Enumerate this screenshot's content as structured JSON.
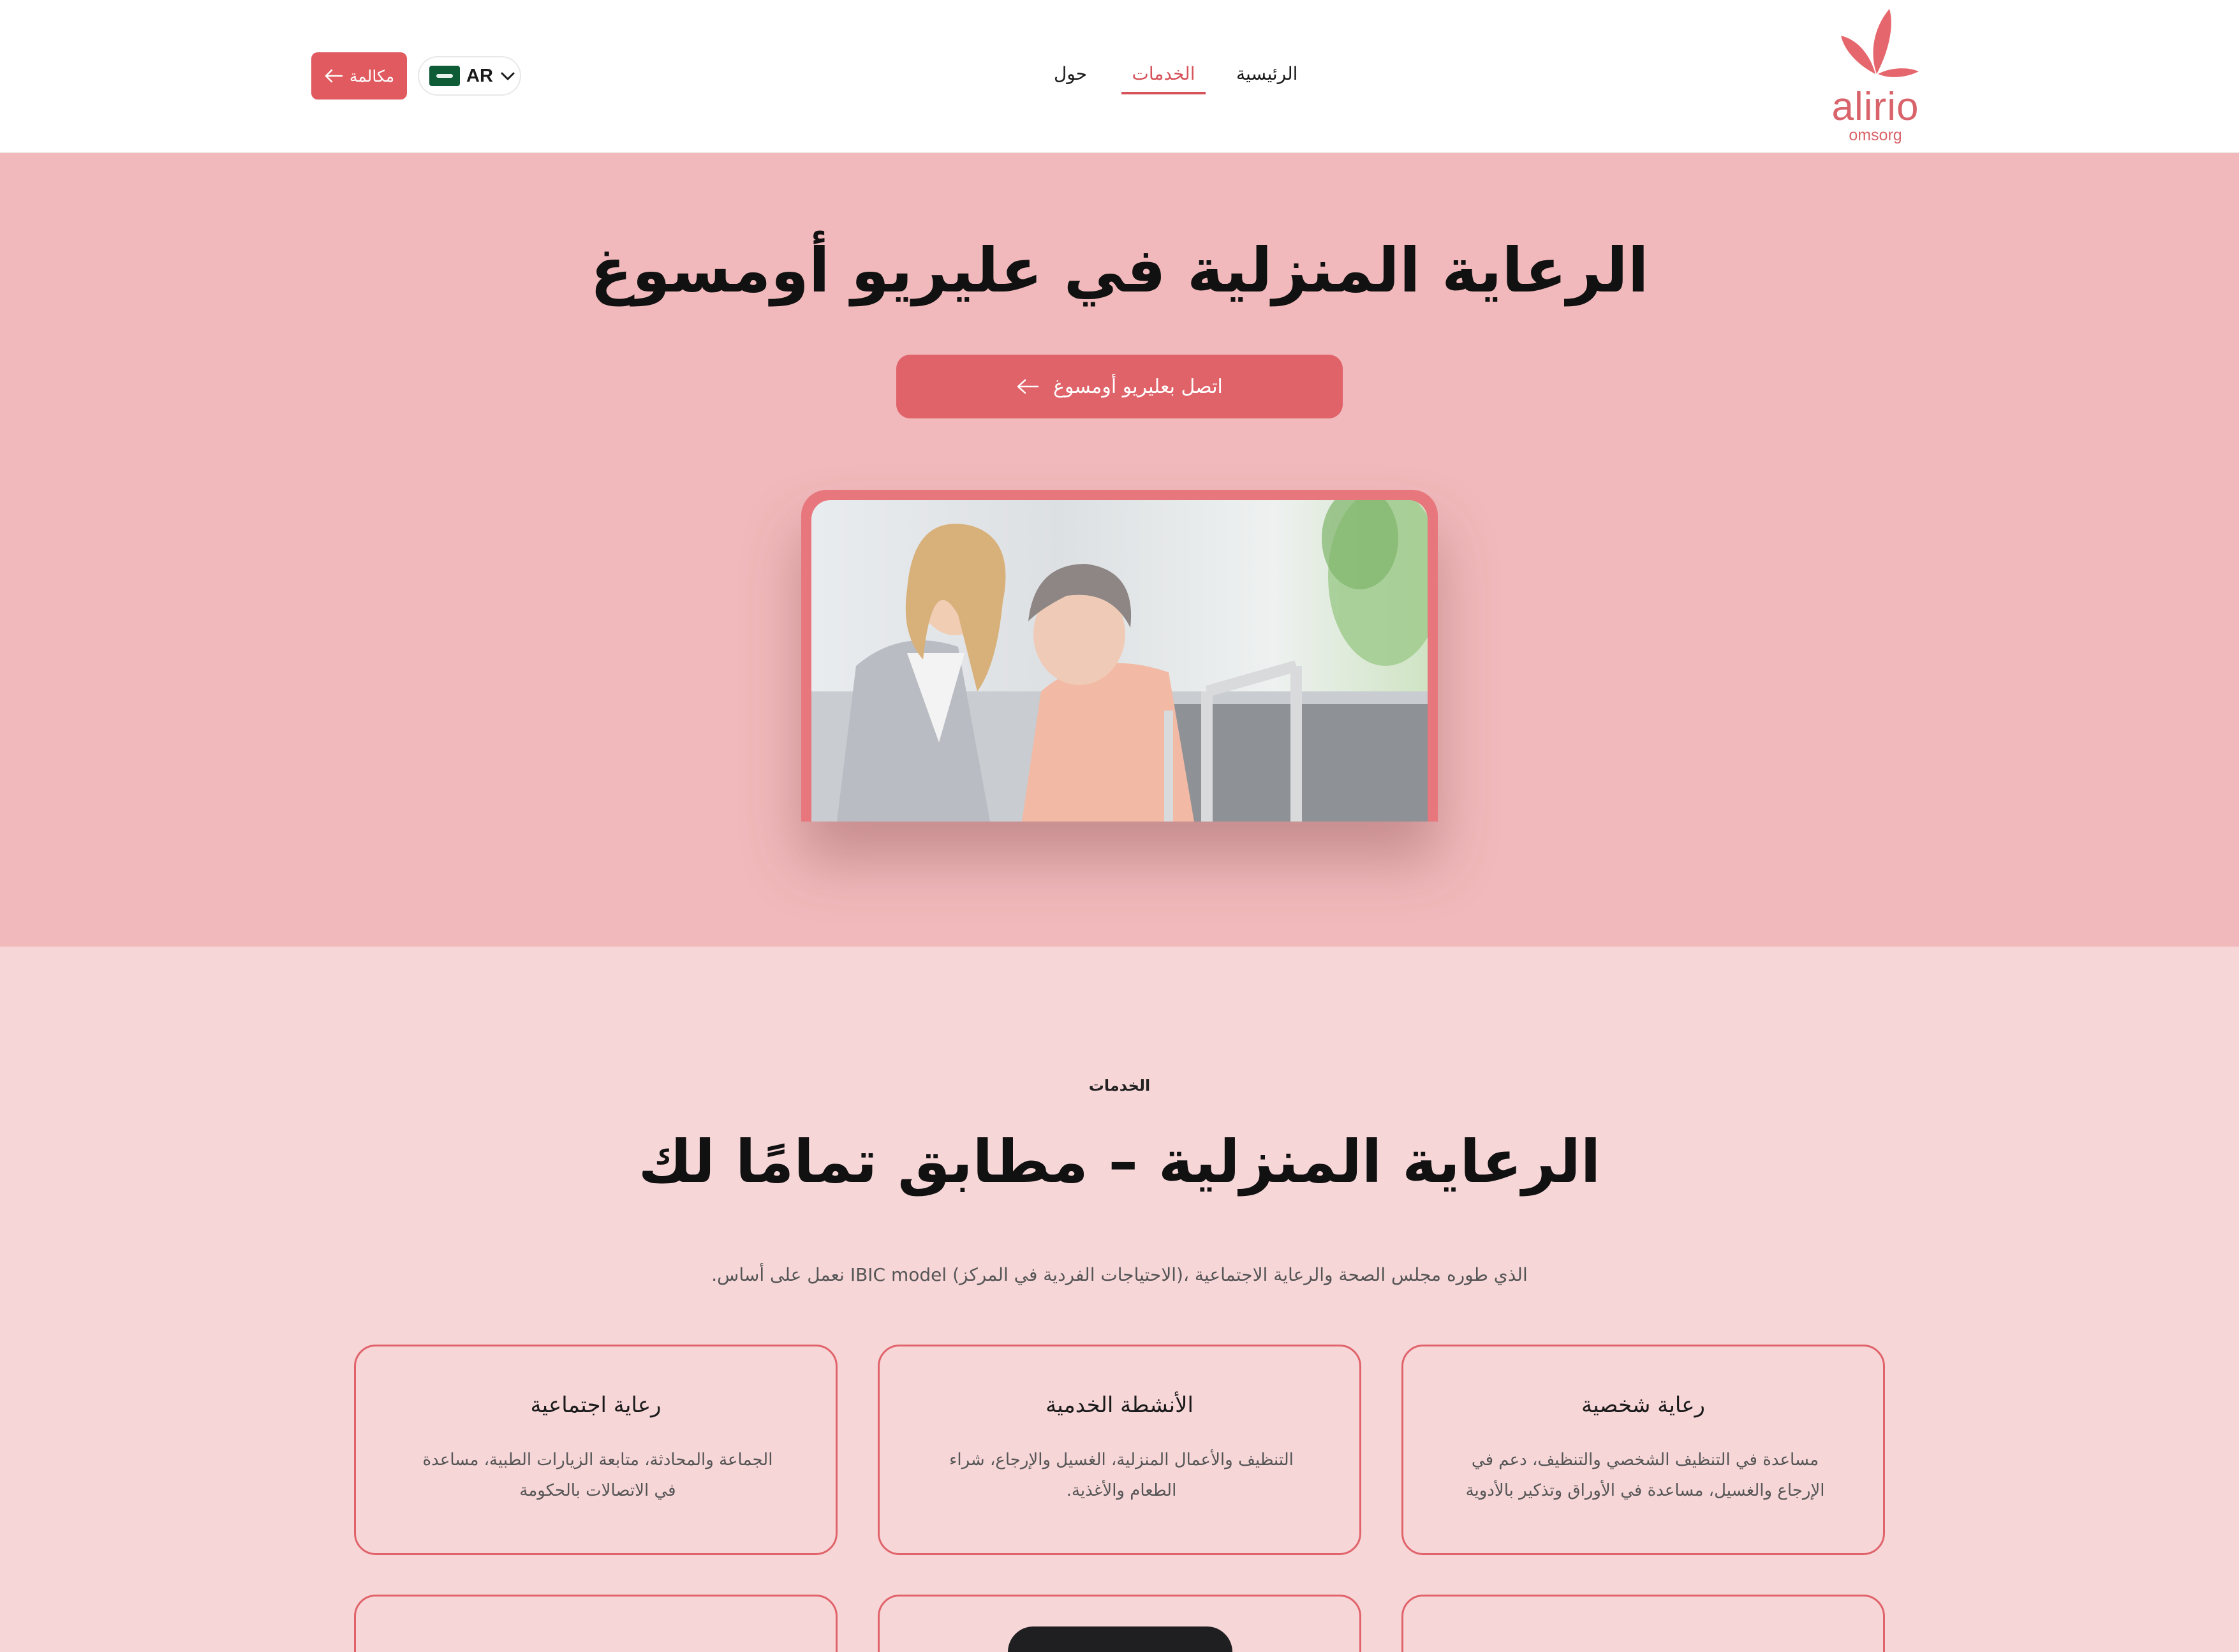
{
  "header": {
    "call_label": "مكالمة",
    "lang_code": "AR",
    "nav": {
      "home": "الرئيسية",
      "services": "الخدمات",
      "about": "حول"
    },
    "logo_word": "alirio",
    "logo_sub": "omsorg"
  },
  "hero": {
    "title": "الرعاية المنزلية في عليريو أومسوغ",
    "button_label": "اتصل بعليريو أومسوغ"
  },
  "services": {
    "kicker": "الخدمات",
    "title": "الرعاية المنزلية – مطابق تمامًا لك",
    "description": "الذي طوره مجلس الصحة والرعاية الاجتماعية ،(الاحتياجات الفردية في المركز) IBIC model نعمل على أساس.",
    "cards": [
      {
        "title": "رعاية شخصية",
        "text": "مساعدة في التنظيف الشخصي والتنظيف، دعم في الإرجاع والغسيل، مساعدة في الأوراق وتذكير بالأدوية"
      },
      {
        "title": "الأنشطة الخدمية",
        "text": "التنظيف والأعمال المنزلية، الغسيل والإرجاع، شراء الطعام والأغذية."
      },
      {
        "title": "رعاية اجتماعية",
        "text": "الجماعة والمحادثة، متابعة الزيارات الطبية، مساعدة في الاتصالات بالحكومة"
      }
    ]
  },
  "colors": {
    "accent": "#e0636a",
    "hero_bg": "#f1b9bb",
    "section_bg": "#f7d6d8"
  },
  "icons": [
    "arrow-left-icon",
    "chevron-down-icon",
    "saudi-flag-icon",
    "butterfly-logo-icon"
  ]
}
